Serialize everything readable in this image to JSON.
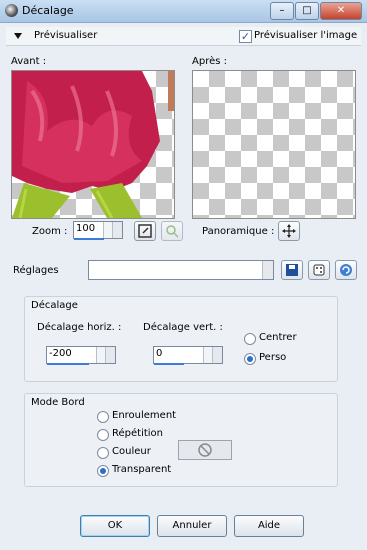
{
  "window": {
    "title": "Décalage",
    "minimize": "–",
    "maximize": "□",
    "close": "✕"
  },
  "preview": {
    "toggle_label": "Prévisualiser",
    "checkbox_label": "Prévisualiser l'image",
    "checkbox_checked": true,
    "before_label": "Avant :",
    "after_label": "Après :",
    "zoom_label": "Zoom :",
    "zoom_value": "100",
    "pan_label": "Panoramique :"
  },
  "settings": {
    "label": "Réglages",
    "value": ""
  },
  "offset_group": {
    "title": "Décalage",
    "horiz_label": "Décalage horiz. :",
    "horiz_value": "-200",
    "vert_label": "Décalage vert. :",
    "vert_value": "0",
    "options": [
      {
        "label": "Centrer",
        "selected": false
      },
      {
        "label": "Perso",
        "selected": true
      }
    ]
  },
  "edge_group": {
    "title": "Mode Bord",
    "options": [
      {
        "label": "Enroulement",
        "selected": false
      },
      {
        "label": "Répétition",
        "selected": false
      },
      {
        "label": "Couleur",
        "selected": false
      },
      {
        "label": "Transparent",
        "selected": true
      }
    ]
  },
  "buttons": {
    "ok": "OK",
    "cancel": "Annuler",
    "help": "Aide"
  }
}
